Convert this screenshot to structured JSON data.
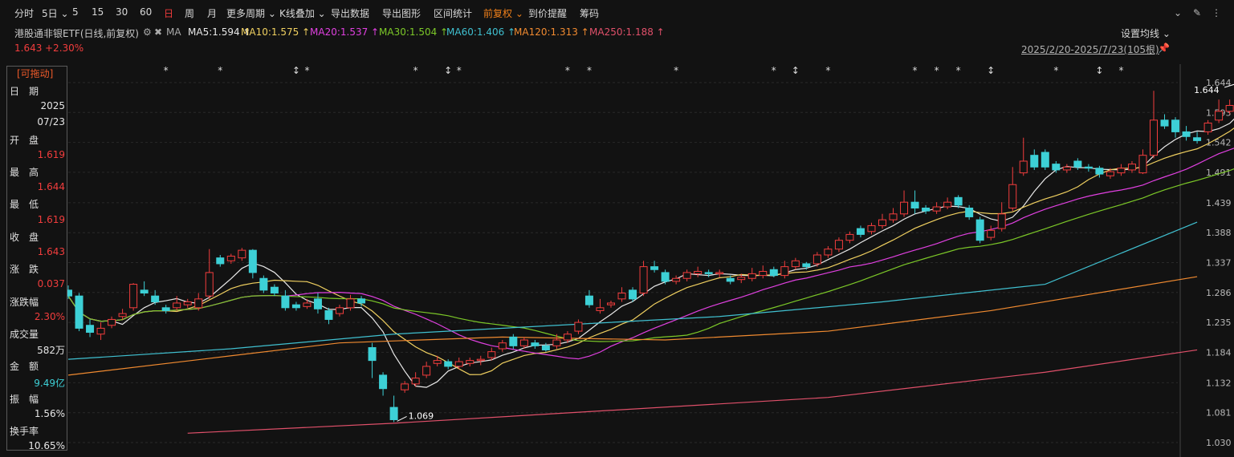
{
  "toolbar": {
    "items": [
      "分时",
      "5日",
      "5",
      "15",
      "30",
      "60",
      "日",
      "周",
      "月",
      "更多周期",
      "K线叠加",
      "导出数据",
      "导出图形",
      "区间统计",
      "前复权",
      "到价提醒",
      "筹码"
    ],
    "active_index": 6
  },
  "info": {
    "title": "港股通非银ETF(日线,前复权)",
    "ma_label": "MA",
    "ma": [
      {
        "label": "MA5:1.594",
        "color": "#e8e8e8"
      },
      {
        "label": "MA10:1.575",
        "color": "#f0d060"
      },
      {
        "label": "MA20:1.537",
        "color": "#e040e0"
      },
      {
        "label": "MA30:1.504",
        "color": "#7cc828"
      },
      {
        "label": "MA60:1.406",
        "color": "#40c0d0"
      },
      {
        "label": "MA120:1.313",
        "color": "#f08a30"
      },
      {
        "label": "MA250:1.188",
        "color": "#e0506a"
      }
    ],
    "set_ma": "设置均线"
  },
  "price_row": {
    "price": "1.643",
    "change": "+2.30%",
    "range": "2025/2/20-2025/7/23(105根)"
  },
  "panel": {
    "drag": "[可拖动]",
    "rows": [
      {
        "label": "日　期",
        "value": ""
      },
      {
        "label": "",
        "value": "2025"
      },
      {
        "label": "",
        "value": "07/23"
      },
      {
        "label": "开　盘",
        "value": ""
      },
      {
        "label": "",
        "value": "1.619"
      },
      {
        "label": "最　高",
        "value": ""
      },
      {
        "label": "",
        "value": "1.644"
      },
      {
        "label": "最　低",
        "value": ""
      },
      {
        "label": "",
        "value": "1.619"
      },
      {
        "label": "收　盘",
        "value": ""
      },
      {
        "label": "",
        "value": "1.643"
      },
      {
        "label": "涨　跌",
        "value": ""
      },
      {
        "label": "",
        "value": "0.037"
      },
      {
        "label": "涨跌幅",
        "value": ""
      },
      {
        "label": "",
        "value": "2.30%"
      },
      {
        "label": "成交量",
        "value": ""
      },
      {
        "label": "",
        "value": "582万"
      },
      {
        "label": "金　额",
        "value": ""
      },
      {
        "label": "",
        "value": "9.49亿"
      },
      {
        "label": "振　幅",
        "value": ""
      },
      {
        "label": "",
        "value": "1.56%"
      },
      {
        "label": "换手率",
        "value": ""
      },
      {
        "label": "",
        "value": "10.65%"
      }
    ]
  },
  "chart_data": {
    "type": "candlestick",
    "y_ticks": [
      "1.644",
      "1.593",
      "1.542",
      "1.491",
      "1.439",
      "1.388",
      "1.337",
      "1.286",
      "1.235",
      "1.184",
      "1.132",
      "1.081",
      "1.030"
    ],
    "ylim": [
      1.03,
      1.644
    ],
    "high_label": "1.644",
    "low_label": "1.069",
    "candles": [
      [
        1.29,
        1.28,
        1.275,
        1.298
      ],
      [
        1.28,
        1.225,
        1.22,
        1.285
      ],
      [
        1.23,
        1.218,
        1.21,
        1.24
      ],
      [
        1.215,
        1.225,
        1.205,
        1.235
      ],
      [
        1.23,
        1.24,
        1.225,
        1.245
      ],
      [
        1.245,
        1.25,
        1.24,
        1.258
      ],
      [
        1.26,
        1.3,
        1.255,
        1.302
      ],
      [
        1.29,
        1.285,
        1.28,
        1.305
      ],
      [
        1.28,
        1.27,
        1.265,
        1.29
      ],
      [
        1.26,
        1.255,
        1.25,
        1.265
      ],
      [
        1.26,
        1.268,
        1.255,
        1.28
      ],
      [
        1.265,
        1.27,
        1.26,
        1.275
      ],
      [
        1.26,
        1.275,
        1.255,
        1.285
      ],
      [
        1.28,
        1.32,
        1.275,
        1.36
      ],
      [
        1.345,
        1.335,
        1.33,
        1.35
      ],
      [
        1.34,
        1.348,
        1.335,
        1.352
      ],
      [
        1.345,
        1.358,
        1.34,
        1.362
      ],
      [
        1.358,
        1.32,
        1.31,
        1.36
      ],
      [
        1.31,
        1.29,
        1.285,
        1.315
      ],
      [
        1.295,
        1.285,
        1.28,
        1.3
      ],
      [
        1.28,
        1.26,
        1.255,
        1.29
      ],
      [
        1.265,
        1.26,
        1.255,
        1.27
      ],
      [
        1.262,
        1.268,
        1.258,
        1.275
      ],
      [
        1.275,
        1.258,
        1.25,
        1.285
      ],
      [
        1.255,
        1.24,
        1.232,
        1.26
      ],
      [
        1.25,
        1.26,
        1.245,
        1.265
      ],
      [
        1.26,
        1.275,
        1.255,
        1.282
      ],
      [
        1.275,
        1.268,
        1.262,
        1.28
      ],
      [
        1.192,
        1.17,
        1.14,
        1.2
      ],
      [
        1.145,
        1.122,
        1.11,
        1.15
      ],
      [
        1.09,
        1.069,
        1.065,
        1.11
      ],
      [
        1.12,
        1.13,
        1.115,
        1.135
      ],
      [
        1.13,
        1.14,
        1.125,
        1.15
      ],
      [
        1.145,
        1.16,
        1.14,
        1.168
      ],
      [
        1.165,
        1.17,
        1.16,
        1.178
      ],
      [
        1.168,
        1.16,
        1.155,
        1.172
      ],
      [
        1.16,
        1.168,
        1.155,
        1.175
      ],
      [
        1.165,
        1.17,
        1.16,
        1.175
      ],
      [
        1.17,
        1.172,
        1.162,
        1.178
      ],
      [
        1.175,
        1.185,
        1.17,
        1.192
      ],
      [
        1.19,
        1.2,
        1.185,
        1.205
      ],
      [
        1.21,
        1.195,
        1.19,
        1.215
      ],
      [
        1.195,
        1.205,
        1.19,
        1.21
      ],
      [
        1.2,
        1.195,
        1.19,
        1.205
      ],
      [
        1.195,
        1.188,
        1.185,
        1.2
      ],
      [
        1.195,
        1.205,
        1.19,
        1.215
      ],
      [
        1.205,
        1.215,
        1.2,
        1.22
      ],
      [
        1.22,
        1.235,
        1.215,
        1.24
      ],
      [
        1.28,
        1.265,
        1.26,
        1.29
      ],
      [
        1.255,
        1.26,
        1.25,
        1.275
      ],
      [
        1.265,
        1.268,
        1.26,
        1.272
      ],
      [
        1.275,
        1.285,
        1.27,
        1.295
      ],
      [
        1.29,
        1.275,
        1.27,
        1.295
      ],
      [
        1.285,
        1.33,
        1.28,
        1.34
      ],
      [
        1.33,
        1.325,
        1.32,
        1.34
      ],
      [
        1.32,
        1.305,
        1.3,
        1.325
      ],
      [
        1.305,
        1.31,
        1.3,
        1.315
      ],
      [
        1.31,
        1.32,
        1.305,
        1.325
      ],
      [
        1.318,
        1.322,
        1.312,
        1.33
      ],
      [
        1.32,
        1.318,
        1.312,
        1.325
      ],
      [
        1.318,
        1.32,
        1.312,
        1.325
      ],
      [
        1.31,
        1.305,
        1.3,
        1.315
      ],
      [
        1.308,
        1.312,
        1.302,
        1.318
      ],
      [
        1.31,
        1.318,
        1.305,
        1.328
      ],
      [
        1.315,
        1.322,
        1.31,
        1.332
      ],
      [
        1.325,
        1.315,
        1.312,
        1.33
      ],
      [
        1.315,
        1.33,
        1.31,
        1.34
      ],
      [
        1.33,
        1.34,
        1.325,
        1.345
      ],
      [
        1.335,
        1.33,
        1.325,
        1.338
      ],
      [
        1.335,
        1.35,
        1.33,
        1.355
      ],
      [
        1.35,
        1.36,
        1.345,
        1.365
      ],
      [
        1.36,
        1.375,
        1.355,
        1.38
      ],
      [
        1.375,
        1.385,
        1.37,
        1.39
      ],
      [
        1.395,
        1.385,
        1.38,
        1.4
      ],
      [
        1.39,
        1.4,
        1.385,
        1.405
      ],
      [
        1.4,
        1.41,
        1.395,
        1.42
      ],
      [
        1.41,
        1.42,
        1.405,
        1.43
      ],
      [
        1.42,
        1.44,
        1.415,
        1.46
      ],
      [
        1.44,
        1.43,
        1.42,
        1.46
      ],
      [
        1.43,
        1.425,
        1.42,
        1.435
      ],
      [
        1.425,
        1.432,
        1.42,
        1.44
      ],
      [
        1.432,
        1.44,
        1.428,
        1.448
      ],
      [
        1.448,
        1.435,
        1.43,
        1.452
      ],
      [
        1.43,
        1.415,
        1.41,
        1.435
      ],
      [
        1.41,
        1.375,
        1.37,
        1.415
      ],
      [
        1.38,
        1.392,
        1.375,
        1.4
      ],
      [
        1.395,
        1.42,
        1.39,
        1.44
      ],
      [
        1.43,
        1.47,
        1.425,
        1.5
      ],
      [
        1.49,
        1.51,
        1.485,
        1.55
      ],
      [
        1.52,
        1.5,
        1.495,
        1.53
      ],
      [
        1.525,
        1.5,
        1.495,
        1.53
      ],
      [
        1.505,
        1.495,
        1.49,
        1.51
      ],
      [
        1.495,
        1.5,
        1.49,
        1.505
      ],
      [
        1.51,
        1.5,
        1.495,
        1.515
      ],
      [
        1.5,
        1.498,
        1.492,
        1.505
      ],
      [
        1.498,
        1.488,
        1.482,
        1.502
      ],
      [
        1.485,
        1.492,
        1.48,
        1.498
      ],
      [
        1.49,
        1.498,
        1.485,
        1.505
      ],
      [
        1.495,
        1.505,
        1.49,
        1.51
      ],
      [
        1.49,
        1.52,
        1.488,
        1.53
      ],
      [
        1.52,
        1.58,
        1.515,
        1.63
      ],
      [
        1.58,
        1.57,
        1.565,
        1.59
      ],
      [
        1.58,
        1.56,
        1.55,
        1.585
      ],
      [
        1.56,
        1.552,
        1.545,
        1.57
      ],
      [
        1.55,
        1.545,
        1.54,
        1.56
      ],
      [
        1.56,
        1.575,
        1.555,
        1.58
      ],
      [
        1.58,
        1.595,
        1.575,
        1.615
      ],
      [
        1.595,
        1.605,
        1.59,
        1.615
      ],
      [
        1.619,
        1.643,
        1.619,
        1.644
      ]
    ],
    "ma_lines": [
      {
        "name": "MA5",
        "color": "#e8e8e8"
      },
      {
        "name": "MA10",
        "color": "#f0d060"
      },
      {
        "name": "MA20",
        "color": "#e040e0"
      },
      {
        "name": "MA30",
        "color": "#7cc828"
      },
      {
        "name": "MA60",
        "color": "#40c0d0",
        "points": [
          [
            0,
            1.172
          ],
          [
            15,
            1.19
          ],
          [
            30,
            1.215
          ],
          [
            45,
            1.23
          ],
          [
            60,
            1.245
          ],
          [
            75,
            1.27
          ],
          [
            90,
            1.3
          ],
          [
            104,
            1.406
          ]
        ]
      },
      {
        "name": "MA120",
        "color": "#f08a30",
        "points": [
          [
            0,
            1.145
          ],
          [
            15,
            1.178
          ],
          [
            25,
            1.2
          ],
          [
            40,
            1.21
          ],
          [
            55,
            1.205
          ],
          [
            70,
            1.22
          ],
          [
            85,
            1.255
          ],
          [
            104,
            1.313
          ]
        ]
      },
      {
        "name": "MA250",
        "color": "#e0506a",
        "points": [
          [
            11,
            1.046
          ],
          [
            30,
            1.063
          ],
          [
            50,
            1.085
          ],
          [
            70,
            1.107
          ],
          [
            90,
            1.15
          ],
          [
            104,
            1.188
          ]
        ]
      }
    ],
    "markers": [
      {
        "i": 9,
        "t": "*"
      },
      {
        "i": 14,
        "t": "*"
      },
      {
        "i": 21,
        "t": "↕"
      },
      {
        "i": 22,
        "t": "*"
      },
      {
        "i": 32,
        "t": "*"
      },
      {
        "i": 35,
        "t": "↕"
      },
      {
        "i": 36,
        "t": "*"
      },
      {
        "i": 46,
        "t": "*"
      },
      {
        "i": 48,
        "t": "*"
      },
      {
        "i": 56,
        "t": "*"
      },
      {
        "i": 65,
        "t": "*"
      },
      {
        "i": 67,
        "t": "↕"
      },
      {
        "i": 70,
        "t": "*"
      },
      {
        "i": 78,
        "t": "*"
      },
      {
        "i": 80,
        "t": "*"
      },
      {
        "i": 82,
        "t": "*"
      },
      {
        "i": 85,
        "t": "↕"
      },
      {
        "i": 91,
        "t": "*"
      },
      {
        "i": 95,
        "t": "↕"
      },
      {
        "i": 97,
        "t": "*"
      }
    ]
  }
}
